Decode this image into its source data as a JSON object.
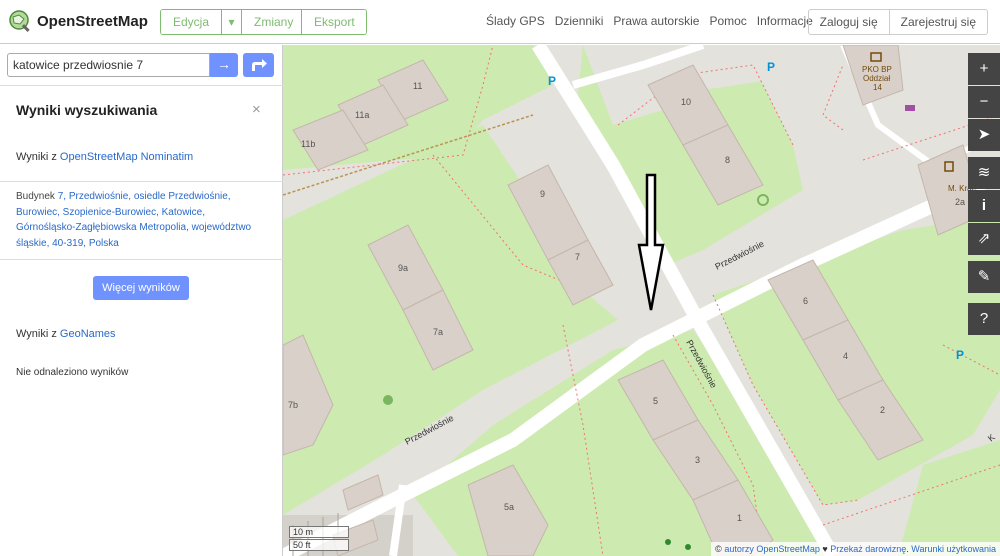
{
  "header": {
    "logo_text": "OpenStreetMap",
    "edit_label": "Edycja",
    "dropdown_glyph": "▾",
    "history_label": "Zmiany",
    "export_label": "Eksport",
    "nav": [
      "Ślady GPS",
      "Dzienniki",
      "Prawa autorskie",
      "Pomoc",
      "Informacje"
    ],
    "login_label": "Zaloguj się",
    "signup_label": "Zarejestruj się"
  },
  "search": {
    "value": "katowice przedwiosnie 7",
    "go_glyph": "→"
  },
  "sidebar": {
    "title": "Wyniki wyszukiwania",
    "close_glyph": "×",
    "nominatim_prefix": "Wyniki z ",
    "nominatim_link": "OpenStreetMap Nominatim",
    "result_prefix": "Budynek ",
    "result_link": "7, Przedwiośnie, osiedle Przedwiośnie, Burowiec, Szopienice-Burowiec, Katowice, Górnośląsko-Zagłębiowska Metropolia, województwo śląskie, 40-319, Polska",
    "more_button": "Więcej wyników",
    "geonames_prefix": "Wyniki z ",
    "geonames_link": "GeoNames",
    "no_results": "Nie odnaleziono wyników"
  },
  "map": {
    "street_labels": [
      "Przedwiośnie",
      "Przedwiośnie",
      "Przedwiośnie"
    ],
    "building_numbers": [
      "11",
      "11a",
      "11b",
      "9",
      "7",
      "9a",
      "7a",
      "7b",
      "10",
      "8",
      "6",
      "4",
      "2",
      "5",
      "3",
      "1",
      "5a",
      "2a"
    ],
    "poi_labels": [
      "PKO BP",
      "Oddział",
      "14",
      "M. Krai"
    ],
    "parking_glyph": "P",
    "edge_label": "K",
    "scale_metric": "10 m",
    "scale_imperial": "50 ft",
    "controls": [
      {
        "name": "zoom-in",
        "glyph": "+"
      },
      {
        "name": "zoom-out",
        "glyph": "−"
      },
      {
        "name": "locate",
        "glyph": "➤"
      },
      {
        "name": "layers",
        "glyph": "≋"
      },
      {
        "name": "info",
        "glyph": "i"
      },
      {
        "name": "share",
        "glyph": "⇗"
      },
      {
        "name": "note",
        "glyph": "✎"
      },
      {
        "name": "query",
        "glyph": "?"
      }
    ],
    "attribution": {
      "copy": "© ",
      "authors_link": "autorzy OpenStreetMap",
      "heart": " ♥ ",
      "donate_link": "Przekaż darowiznę",
      "sep": ". ",
      "terms_link": "Warunki użytkowania"
    }
  },
  "colors": {
    "accent_green": "#7ebc6f",
    "button_blue": "#7092ff",
    "link_blue": "#2a69c9",
    "grass": "#cdebb0",
    "building": "#d9d0c9",
    "road": "#ffffff"
  }
}
